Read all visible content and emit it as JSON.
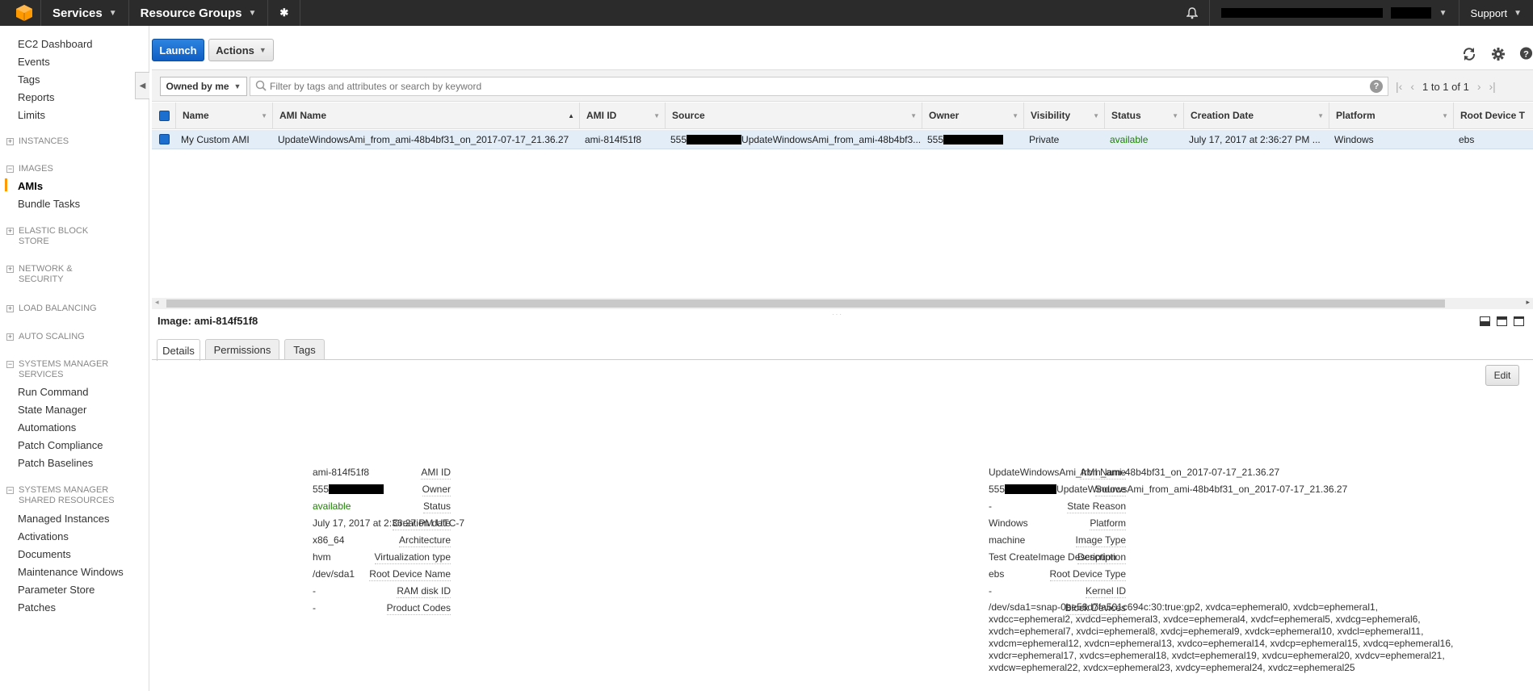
{
  "topnav": {
    "services": "Services",
    "resource_groups": "Resource Groups",
    "support": "Support"
  },
  "sidebar": {
    "items": [
      {
        "label": "EC2 Dashboard"
      },
      {
        "label": "Events"
      },
      {
        "label": "Tags"
      },
      {
        "label": "Reports"
      },
      {
        "label": "Limits"
      }
    ],
    "sections": {
      "instances": "INSTANCES",
      "images": "IMAGES",
      "ebs": "ELASTIC BLOCK STORE",
      "network": "NETWORK & SECURITY",
      "lb": "LOAD BALANCING",
      "autoscaling": "AUTO SCALING",
      "ssm": "SYSTEMS MANAGER SERVICES",
      "ssm_shared": "SYSTEMS MANAGER SHARED RESOURCES"
    },
    "images_items": [
      "AMIs",
      "Bundle Tasks"
    ],
    "ssm_items": [
      "Run Command",
      "State Manager",
      "Automations",
      "Patch Compliance",
      "Patch Baselines"
    ],
    "shared_items": [
      "Managed Instances",
      "Activations",
      "Documents",
      "Maintenance Windows",
      "Parameter Store",
      "Patches"
    ]
  },
  "toolbar": {
    "launch": "Launch",
    "actions": "Actions"
  },
  "filter": {
    "owner_select": "Owned by me",
    "search_placeholder": "Filter by tags and attributes or search by keyword",
    "pager_text": "1 to 1 of 1"
  },
  "table": {
    "columns": [
      "Name",
      "AMI Name",
      "AMI ID",
      "Source",
      "Owner",
      "Visibility",
      "Status",
      "Creation Date",
      "Platform",
      "Root Device T"
    ],
    "row": {
      "name": "My Custom AMI",
      "ami_name": "UpdateWindowsAmi_from_ami-48b4bf31_on_2017-07-17_21.36.27",
      "ami_id": "ami-814f51f8",
      "source_prefix": "555",
      "source_suffix": "UpdateWindowsAmi_from_ami-48b4bf3...",
      "owner_prefix": "555",
      "visibility": "Private",
      "status": "available",
      "creation_date": "July 17, 2017 at 2:36:27 PM ...",
      "platform": "Windows",
      "root_device": "ebs"
    }
  },
  "detail": {
    "title": "Image: ami-814f51f8",
    "tabs": [
      "Details",
      "Permissions",
      "Tags"
    ],
    "edit": "Edit",
    "left": {
      "labels": [
        "AMI ID",
        "Owner",
        "Status",
        "Creation date",
        "Architecture",
        "Virtualization type",
        "Root Device Name",
        "RAM disk ID",
        "Product Codes"
      ],
      "values": [
        "ami-814f51f8",
        "555",
        "available",
        "July 17, 2017 at 2:36:27 PM UTC-7",
        "x86_64",
        "hvm",
        "/dev/sda1",
        "-",
        "-"
      ]
    },
    "right": {
      "labels": [
        "AMI Name",
        "Source",
        "State Reason",
        "Platform",
        "Image Type",
        "Description",
        "Root Device Type",
        "Kernel ID",
        "Block Devices"
      ],
      "values": [
        "UpdateWindowsAmi_from_ami-48b4bf31_on_2017-07-17_21.36.27",
        "555",
        "-",
        "Windows",
        "machine",
        "Test CreateImage Description",
        "ebs",
        "-",
        ""
      ],
      "source_suffix": "UpdateWindowsAmi_from_ami-48b4bf31_on_2017-07-17_21.36.27",
      "block_devices": "/dev/sda1=snap-0be58d7fa501c694c:30:true:gp2, xvdca=ephemeral0, xvdcb=ephemeral1, xvdcc=ephemeral2, xvdcd=ephemeral3, xvdce=ephemeral4, xvdcf=ephemeral5, xvdcg=ephemeral6, xvdch=ephemeral7, xvdci=ephemeral8, xvdcj=ephemeral9, xvdck=ephemeral10, xvdcl=ephemeral11, xvdcm=ephemeral12, xvdcn=ephemeral13, xvdco=ephemeral14, xvdcp=ephemeral15, xvdcq=ephemeral16, xvdcr=ephemeral17, xvdcs=ephemeral18, xvdct=ephemeral19, xvdcu=ephemeral20, xvdcv=ephemeral21, xvdcw=ephemeral22, xvdcx=ephemeral23, xvdcy=ephemeral24, xvdcz=ephemeral25"
    }
  },
  "colors": {
    "accent_blue": "#1a73d9",
    "status_green": "#1d8102",
    "nav_bg": "#2b2b2b",
    "selected_row": "#e2edf8",
    "active_bar": "#ff9900"
  }
}
